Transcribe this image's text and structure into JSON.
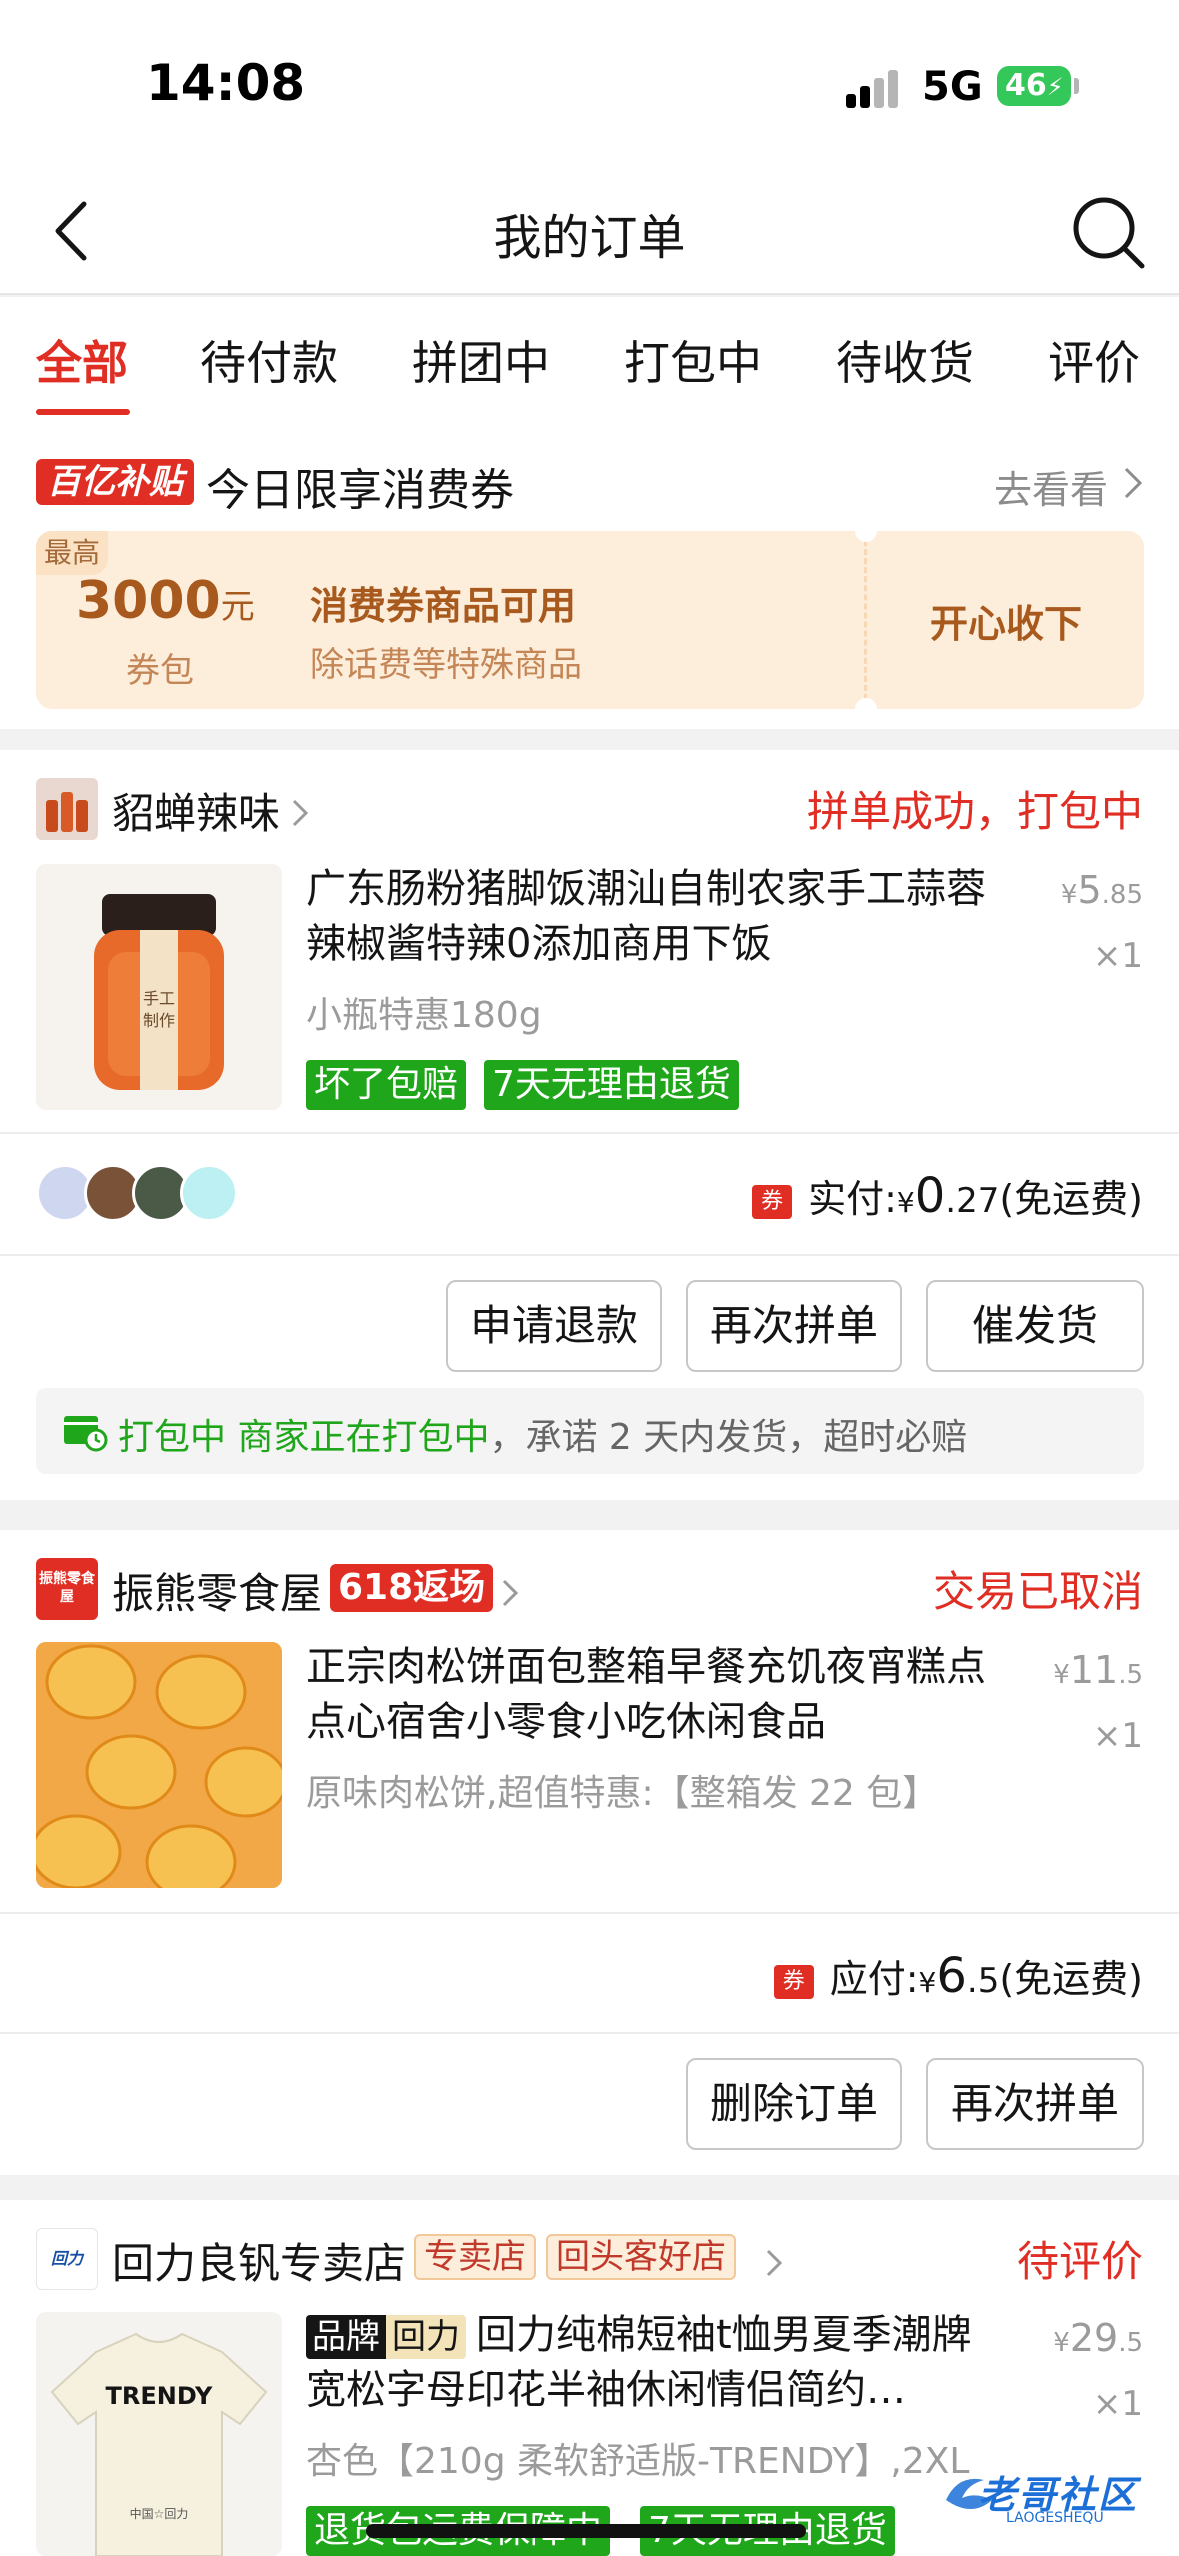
{
  "status_bar": {
    "time": "14:08",
    "network": "5G",
    "battery": "46"
  },
  "nav": {
    "title": "我的订单"
  },
  "tabs": [
    "全部",
    "待付款",
    "拼团中",
    "打包中",
    "待收货",
    "评价"
  ],
  "coupon": {
    "badge": "百亿补贴",
    "headline": "今日限享消费券",
    "more": "去看看",
    "corner": "最高",
    "amount": "3000",
    "amount_unit": "元",
    "amount_sub": "券包",
    "title": "消费券商品可用",
    "desc": "除话费等特殊商品",
    "action": "开心收下"
  },
  "orders": [
    {
      "shop": "貂蝉辣味",
      "status": "拼单成功，打包中",
      "title": "广东肠粉猪脚饭潮汕自制农家手工蒜蓉辣椒酱特辣0添加商用下饭",
      "spec": "小瓶特惠180g",
      "price_symbol": "¥",
      "price_int": "5",
      "price_dec": ".85",
      "qty": "×1",
      "tags": [
        "坏了包赔",
        "7天无理由退货"
      ],
      "pay_label": "实付: ",
      "pay_symbol": "¥",
      "pay_int": "0",
      "pay_dec": ".27",
      "pay_note": " (免运费)",
      "coupon_icon": "券",
      "buttons": [
        "申请退款",
        "再次拼单",
        "催发货"
      ],
      "notice_green": "打包中 商家正在打包中",
      "notice_gray": "，承诺 2 天内发货，超时必赔"
    },
    {
      "shop": "振熊零食屋",
      "shop_logo_text": "振熊零食屋",
      "promo_tag": "618返场",
      "status": "交易已取消",
      "title": "正宗肉松饼面包整箱早餐充饥夜宵糕点点心宿舍小零食小吃休闲食品",
      "spec": "原味肉松饼,超值特惠:【整箱发 22 包】",
      "price_symbol": "¥",
      "price_int": "11",
      "price_dec": ".5",
      "qty": "×1",
      "pay_label": "应付: ",
      "pay_symbol": "¥",
      "pay_int": "6",
      "pay_dec": ".5",
      "pay_note": " (免运费)",
      "coupon_icon": "券",
      "buttons": [
        "删除订单",
        "再次拼单"
      ]
    },
    {
      "shop": "回力良钒专卖店",
      "shop_logo_text": "回力",
      "store_tag": "专卖店",
      "repeat_tag": "回头客好店",
      "status": "待评价",
      "brand_tag": "品牌",
      "brand_name": "回力",
      "title": "回力纯棉短袖t恤男夏季潮牌宽松字母印花半袖休闲情侣简约…",
      "spec": "杏色【210g 柔软舒适版-TRENDY】,2XL",
      "price_symbol": "¥",
      "price_int": "29",
      "price_dec": ".5",
      "qty": "×1",
      "tags": [
        "退货包运费保障中",
        "7天无理由退货"
      ],
      "img_text": "TRENDY",
      "img_sub": "中国☆回力"
    }
  ],
  "watermark": {
    "text": "老哥社区",
    "sub": "LAOGESHEQU"
  },
  "colors": {
    "accent": "#e02e24",
    "green": "#1fa61b",
    "coupon_bg": "#fdeedb",
    "coupon_text": "#a8591d"
  },
  "icons": [
    "back-chevron-icon",
    "search-icon",
    "chevron-right-icon",
    "truck-clock-icon",
    "coupon-icon"
  ]
}
